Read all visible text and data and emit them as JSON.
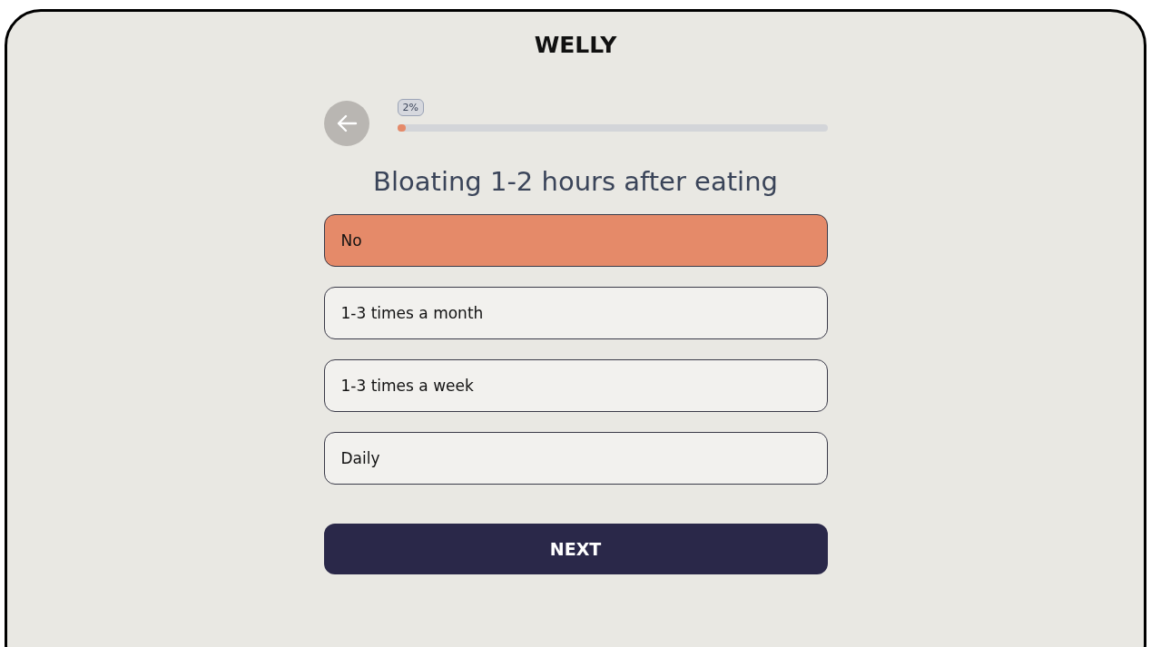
{
  "brand": "WELLY",
  "progress": {
    "label": "2%",
    "level": 0.02
  },
  "question": "Bloating 1-2 hours after eating",
  "options": [
    {
      "label": "No",
      "selected": true
    },
    {
      "label": "1-3 times a month",
      "selected": false
    },
    {
      "label": "1-3 times a week",
      "selected": false
    },
    {
      "label": "Daily",
      "selected": false
    }
  ],
  "next_button": "NEXT"
}
